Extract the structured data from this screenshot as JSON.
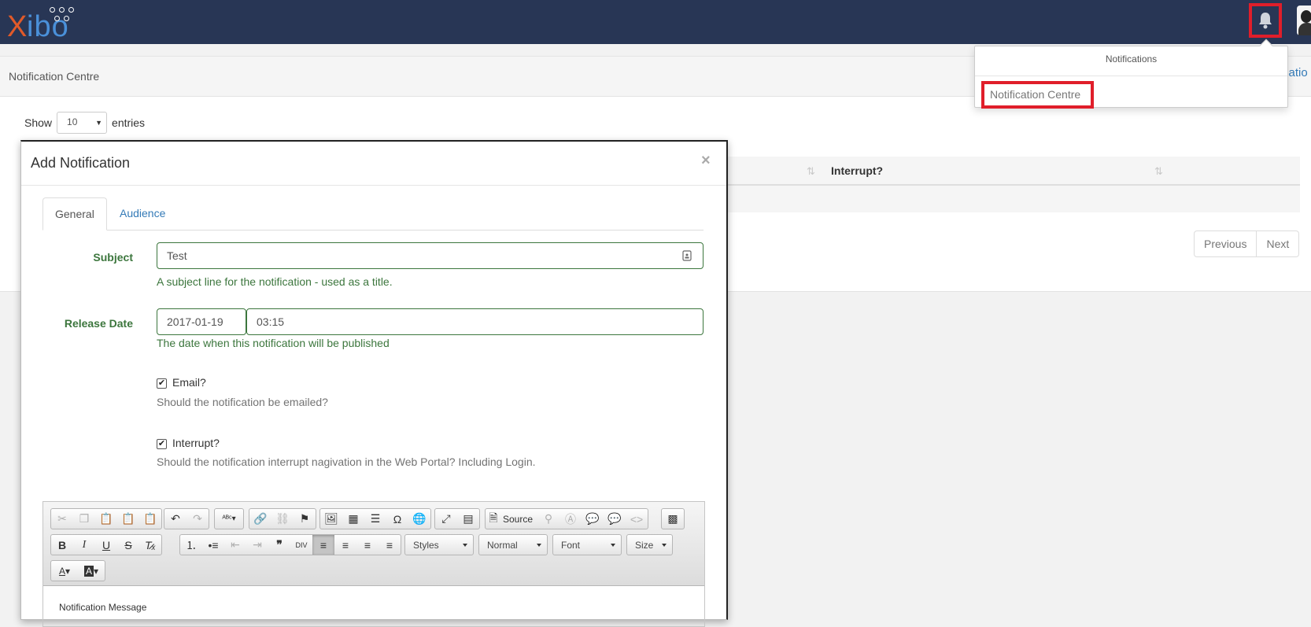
{
  "app": {
    "logo_text_x": "X",
    "logo_text_ibo": "ibo",
    "brand_color": "#283655",
    "highlight_color": "#e01e2a"
  },
  "breadcrumb": {
    "title": "Notification Centre",
    "right_link": "catio"
  },
  "table": {
    "show_label": "Show",
    "entries_value": "10",
    "entries_label": "entries",
    "column_interrupt": "Interrupt?",
    "pager": {
      "previous": "Previous",
      "next": "Next"
    }
  },
  "notifications_dropdown": {
    "title": "Notifications",
    "item": "Notification Centre"
  },
  "modal": {
    "title": "Add Notification",
    "close": "×",
    "tabs": [
      {
        "label": "General",
        "active": true
      },
      {
        "label": "Audience",
        "active": false
      }
    ],
    "subject": {
      "label": "Subject",
      "value": "Test",
      "help": "A subject line for the notification - used as a title."
    },
    "release_date": {
      "label": "Release Date",
      "date": "2017-01-19",
      "time": "03:15",
      "help": "The date when this notification will be published"
    },
    "email": {
      "label": "Email?",
      "checked": true,
      "help": "Should the notification be emailed?"
    },
    "interrupt": {
      "label": "Interrupt?",
      "checked": true,
      "help": "Should the notification interrupt nagivation in the Web Portal? Including Login."
    },
    "editor": {
      "source_label": "Source",
      "styles": "Styles",
      "format": "Normal",
      "font": "Font",
      "size": "Size",
      "content": "Notification Message",
      "bold": "B",
      "italic": "I",
      "underline": "U",
      "strike": "S"
    }
  }
}
